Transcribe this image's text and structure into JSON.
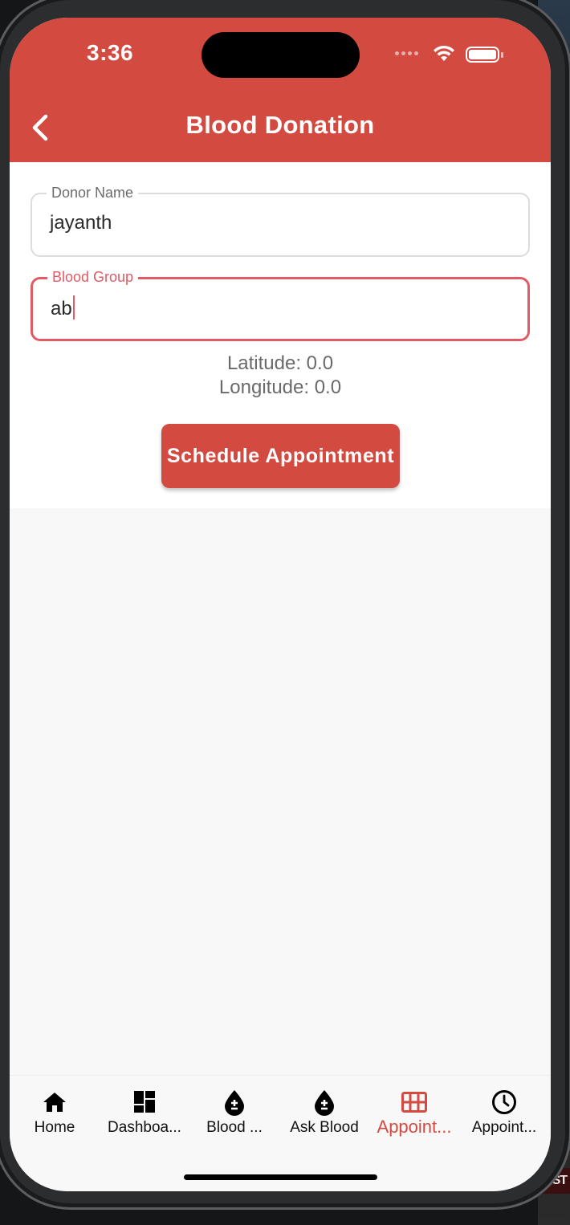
{
  "status_bar": {
    "time": "3:36"
  },
  "appbar": {
    "title": "Blood Donation"
  },
  "form": {
    "donor_name": {
      "label": "Donor Name",
      "value": "jayanth"
    },
    "blood_group": {
      "label": "Blood Group",
      "value": "ab"
    },
    "latitude_text": "Latitude: 0.0",
    "longitude_text": "Longitude: 0.0",
    "schedule_button": "Schedule Appointment"
  },
  "bottom_nav": {
    "items": [
      {
        "label": "Home",
        "icon": "home-icon"
      },
      {
        "label": "Dashboa...",
        "icon": "dashboard-icon"
      },
      {
        "label": "Blood ...",
        "icon": "blood-drop-icon"
      },
      {
        "label": "Ask Blood",
        "icon": "blood-drop-icon"
      },
      {
        "label": "Appoint...",
        "icon": "grid-icon",
        "active": true
      },
      {
        "label": "Appoint...",
        "icon": "clock-icon"
      }
    ]
  },
  "colors": {
    "accent": "#d34a40",
    "focus": "#e25a64"
  }
}
